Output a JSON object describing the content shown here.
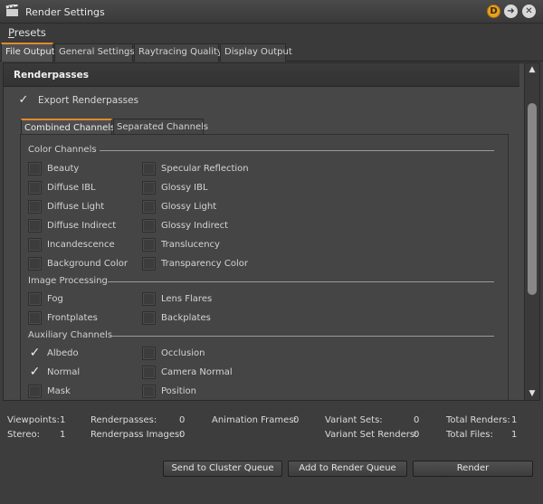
{
  "window": {
    "title": "Render Settings",
    "badge": "D"
  },
  "menu": {
    "presets_prefix": "P",
    "presets_rest": "resets"
  },
  "main_tabs": [
    "File Output",
    "General Settings",
    "Raytracing Quality",
    "Display Output"
  ],
  "section": {
    "title": "Renderpasses"
  },
  "export": {
    "label": "Export Renderpasses",
    "checked": true
  },
  "inner_tabs": [
    "Combined Channels",
    "Separated Channels"
  ],
  "groups": {
    "color": {
      "label": "Color Channels",
      "left": [
        {
          "label": "Beauty",
          "checked": false
        },
        {
          "label": "Diffuse IBL",
          "checked": false
        },
        {
          "label": "Diffuse Light",
          "checked": false
        },
        {
          "label": "Diffuse Indirect",
          "checked": false
        },
        {
          "label": "Incandescence",
          "checked": false
        },
        {
          "label": "Background Color",
          "checked": false
        }
      ],
      "right": [
        {
          "label": "Specular Reflection",
          "checked": false
        },
        {
          "label": "Glossy IBL",
          "checked": false
        },
        {
          "label": "Glossy Light",
          "checked": false
        },
        {
          "label": "Glossy Indirect",
          "checked": false
        },
        {
          "label": "Translucency",
          "checked": false
        },
        {
          "label": "Transparency Color",
          "checked": false
        }
      ]
    },
    "image": {
      "label": "Image Processing",
      "left": [
        {
          "label": "Fog",
          "checked": false
        },
        {
          "label": "Frontplates",
          "checked": false
        }
      ],
      "right": [
        {
          "label": "Lens Flares",
          "checked": false
        },
        {
          "label": "Backplates",
          "checked": false
        }
      ]
    },
    "aux": {
      "label": "Auxiliary Channels",
      "left": [
        {
          "label": "Albedo",
          "checked": true
        },
        {
          "label": "Normal",
          "checked": true
        },
        {
          "label": "Mask",
          "checked": false
        }
      ],
      "right": [
        {
          "label": "Occlusion",
          "checked": false
        },
        {
          "label": "Camera Normal",
          "checked": false
        },
        {
          "label": "Position",
          "checked": false
        }
      ]
    }
  },
  "stats": {
    "viewpoints_label": "Viewpoints:",
    "viewpoints": "1",
    "stereo_label": "Stereo:",
    "stereo": "1",
    "renderpasses_label": "Renderpasses:",
    "renderpasses": "0",
    "renderpass_images_label": "Renderpass Images:",
    "renderpass_images": "0",
    "animation_frames_label": "Animation Frames:",
    "animation_frames": "0",
    "variant_sets_label": "Variant Sets:",
    "variant_sets": "0",
    "variant_set_renders_label": "Variant Set Renders:",
    "variant_set_renders": "0",
    "total_renders_label": "Total Renders:",
    "total_renders": "1",
    "total_files_label": "Total Files:",
    "total_files": "1"
  },
  "buttons": {
    "cluster": "Send to Cluster Queue",
    "queue": "Add to Render Queue",
    "render": "Render"
  },
  "icons": {
    "app": "clapperboard-icon",
    "badge": "d-badge-icon",
    "arrow": "arrow-right-icon",
    "close": "close-icon",
    "scroll_up": "triangle-up-icon",
    "scroll_down": "triangle-down-icon",
    "check": "checkmark-icon"
  },
  "colors": {
    "accent": "#e08a2a",
    "badge": "#e8a020"
  }
}
